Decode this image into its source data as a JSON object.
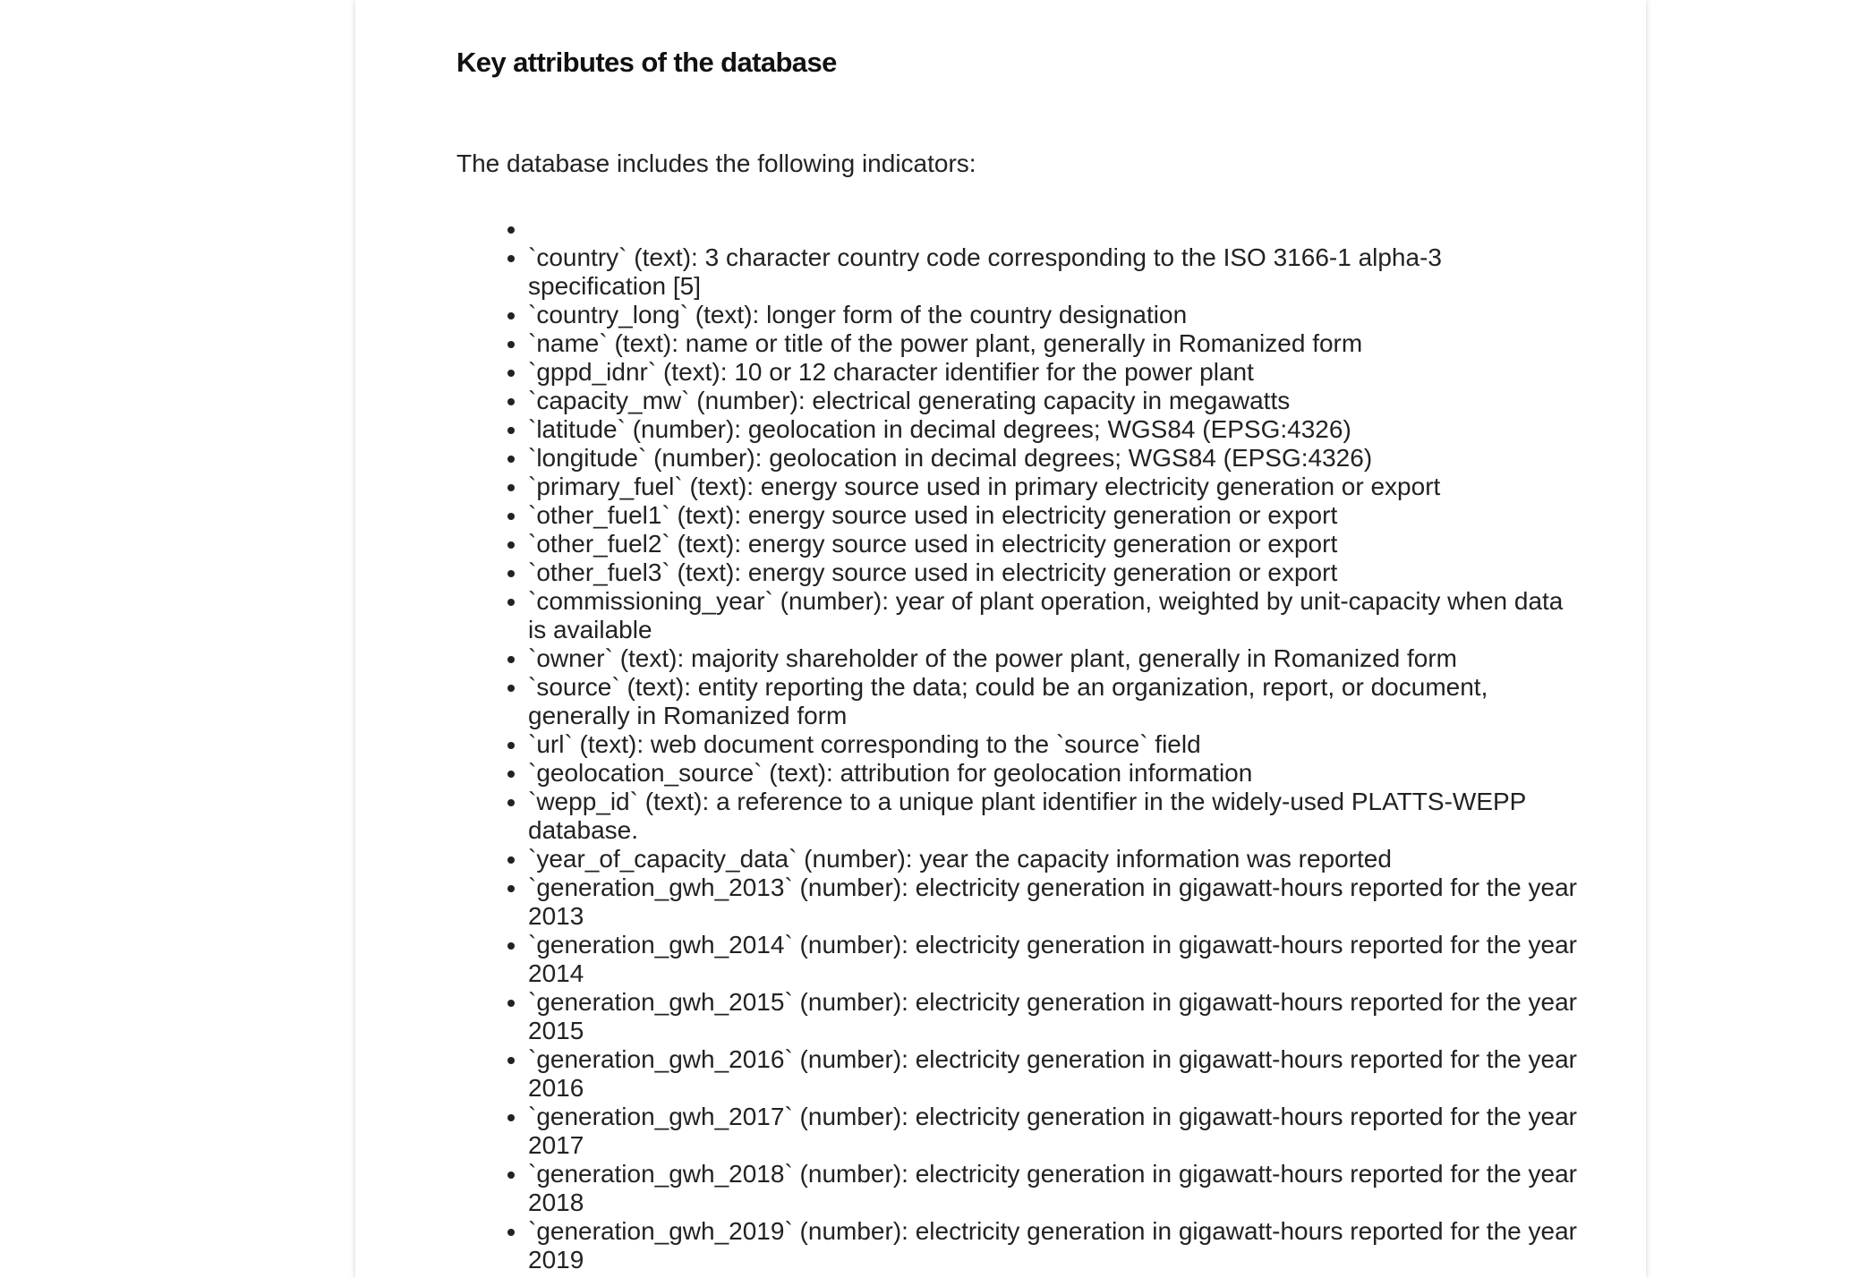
{
  "document": {
    "heading": "Key attributes of the database",
    "intro": "The database includes the following indicators:",
    "items": [
      "",
      "`country` (text): 3 character country code corresponding to the ISO 3166-1 alpha-3 specification [5]",
      "`country_long` (text): longer form of the country designation",
      "`name` (text): name or title of the power plant, generally in Romanized form",
      "`gppd_idnr` (text): 10 or 12 character identifier for the power plant",
      "`capacity_mw` (number): electrical generating capacity in megawatts",
      "`latitude` (number): geolocation in decimal degrees; WGS84 (EPSG:4326)",
      "`longitude` (number): geolocation in decimal degrees; WGS84 (EPSG:4326)",
      "`primary_fuel` (text): energy source used in primary electricity generation or export",
      "`other_fuel1` (text): energy source used in electricity generation or export",
      "`other_fuel2` (text): energy source used in electricity generation or export",
      "`other_fuel3` (text): energy source used in electricity generation or export",
      " `commissioning_year` (number): year of plant operation, weighted by unit-capacity when data is available",
      "`owner` (text): majority shareholder of the power plant, generally in Romanized form",
      "`source` (text): entity reporting the data; could be an organization, report, or document, generally in Romanized form",
      "`url` (text): web document corresponding to the `source` field",
      "`geolocation_source` (text): attribution for geolocation information",
      "`wepp_id` (text): a reference to a unique plant identifier in the widely-used PLATTS-WEPP database.",
      "`year_of_capacity_data` (number): year the capacity information was reported",
      "`generation_gwh_2013` (number): electricity generation in gigawatt-hours reported for the year 2013",
      "`generation_gwh_2014` (number): electricity generation in gigawatt-hours reported for the year 2014",
      "`generation_gwh_2015` (number): electricity generation in gigawatt-hours reported for the year 2015",
      "`generation_gwh_2016` (number): electricity generation in gigawatt-hours reported for the year 2016",
      "`generation_gwh_2017` (number): electricity generation in gigawatt-hours reported for the year 2017",
      "`generation_gwh_2018` (number): electricity generation in gigawatt-hours reported for the year 2018",
      "`generation_gwh_2019` (number): electricity generation in gigawatt-hours reported for the year 2019"
    ]
  }
}
